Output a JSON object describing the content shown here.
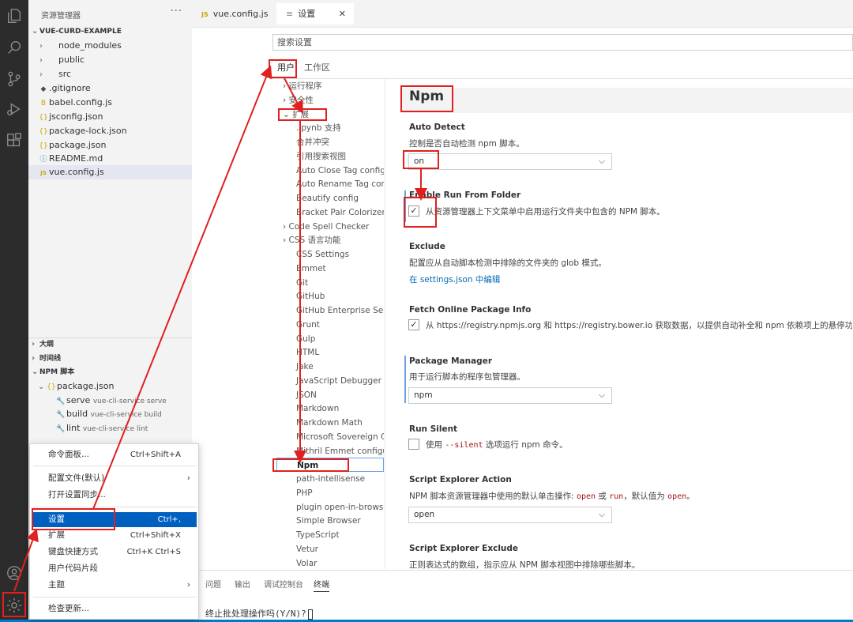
{
  "explorer": {
    "title": "资源管理器",
    "more": "···",
    "project": "VUE-CURD-EXAMPLE",
    "files": [
      {
        "chev": "›",
        "icon": "",
        "name": "node_modules"
      },
      {
        "chev": "›",
        "icon": "",
        "name": "public"
      },
      {
        "chev": "›",
        "icon": "",
        "name": "src"
      },
      {
        "chev": "",
        "icon": "◆",
        "name": ".gitignore"
      },
      {
        "chev": "",
        "icon": "B",
        "name": "babel.config.js"
      },
      {
        "chev": "",
        "icon": "{}",
        "name": "jsconfig.json"
      },
      {
        "chev": "",
        "icon": "{}",
        "name": "package-lock.json"
      },
      {
        "chev": "",
        "icon": "{}",
        "name": "package.json"
      },
      {
        "chev": "",
        "icon": "ⓘ",
        "name": "README.md"
      },
      {
        "chev": "",
        "icon": "JS",
        "name": "vue.config.js"
      }
    ],
    "outline": "大纲",
    "timeline": "时间线",
    "npm_scripts": "NPM 脚本",
    "npm_package": "package.json",
    "scripts": [
      {
        "name": "serve",
        "cmd": "vue-cli-service serve"
      },
      {
        "name": "build",
        "cmd": "vue-cli-service build"
      },
      {
        "name": "lint",
        "cmd": "vue-cli-service lint"
      }
    ]
  },
  "tabs": [
    {
      "badge": "JS",
      "label": "vue.config.js"
    },
    {
      "badge": "≡",
      "label": "设置",
      "close": "✕"
    }
  ],
  "settings": {
    "search_placeholder": "搜索设置",
    "scope_user": "用户",
    "scope_workspace": "工作区",
    "toc": [
      {
        "label": "› 运行程序",
        "indent": 0
      },
      {
        "label": "› 安全性",
        "indent": 0
      },
      {
        "label": "⌄ 扩展",
        "indent": 0
      },
      {
        "label": ".ipynb 支持",
        "indent": 1
      },
      {
        "label": "合并冲突",
        "indent": 1
      },
      {
        "label": "引用搜索视图",
        "indent": 1
      },
      {
        "label": "Auto Close Tag config...",
        "indent": 1
      },
      {
        "label": "Auto Rename Tag con...",
        "indent": 1
      },
      {
        "label": "Beautify config",
        "indent": 1
      },
      {
        "label": "Bracket Pair Colorizer 2",
        "indent": 1
      },
      {
        "label": "› Code Spell Checker",
        "indent": 0
      },
      {
        "label": "› CSS 语言功能",
        "indent": 0
      },
      {
        "label": "CSS Settings",
        "indent": 1
      },
      {
        "label": "Emmet",
        "indent": 1
      },
      {
        "label": "Git",
        "indent": 1
      },
      {
        "label": "GitHub",
        "indent": 1
      },
      {
        "label": "GitHub Enterprise Ser...",
        "indent": 1
      },
      {
        "label": "Grunt",
        "indent": 1
      },
      {
        "label": "Gulp",
        "indent": 1
      },
      {
        "label": "HTML",
        "indent": 1
      },
      {
        "label": "Jake",
        "indent": 1
      },
      {
        "label": "JavaScript Debugger",
        "indent": 1
      },
      {
        "label": "JSON",
        "indent": 1
      },
      {
        "label": "Markdown",
        "indent": 1
      },
      {
        "label": "Markdown Math",
        "indent": 1
      },
      {
        "label": "Microsoft Sovereign C...",
        "indent": 1
      },
      {
        "label": "Mithril Emmet configu...",
        "indent": 1
      },
      {
        "label": "Npm",
        "indent": 1
      },
      {
        "label": "path-intellisense",
        "indent": 1
      },
      {
        "label": "PHP",
        "indent": 1
      },
      {
        "label": "plugin open-in-browser",
        "indent": 1
      },
      {
        "label": "Simple Browser",
        "indent": 1
      },
      {
        "label": "TypeScript",
        "indent": 1
      },
      {
        "label": "Vetur",
        "indent": 1
      },
      {
        "label": "Volar",
        "indent": 1
      }
    ],
    "section_title": "Npm",
    "auto_detect": {
      "title": "Auto Detect",
      "desc": "控制是否自动检测 npm 脚本。",
      "value": "on"
    },
    "run_from_folder": {
      "title": "Enable Run From Folder",
      "label": "从资源管理器上下文菜单中启用运行文件夹中包含的 NPM 脚本。",
      "check": "✓"
    },
    "exclude": {
      "title": "Exclude",
      "desc": "配置应从自动脚本检测中排除的文件夹的 glob 模式。",
      "link": "在 settings.json 中编辑"
    },
    "fetch_info": {
      "title": "Fetch Online Package Info",
      "label": "从 https://registry.npmjs.org 和 https://registry.bower.io 获取数据，以提供自动补全和 npm 依赖项上的悬停功能信息。",
      "check": "✓"
    },
    "package_manager": {
      "title": "Package Manager",
      "desc": "用于运行脚本的程序包管理器。",
      "value": "npm"
    },
    "run_silent": {
      "title": "Run Silent",
      "pre": "使用 ",
      "code": "--silent",
      "post": " 选项运行 npm 命令。"
    },
    "explorer_action": {
      "title": "Script Explorer Action",
      "d1": "NPM 脚本资源管理器中使用的默认单击操作: ",
      "c1": "open",
      "d2": " 或 ",
      "c2": "run",
      "d3": "，默认值为 ",
      "c3": "open",
      "d4": "。",
      "value": "open"
    },
    "explorer_exclude": {
      "title": "Script Explorer Exclude",
      "desc": "正则表达式的数组，指示应从 NPM 脚本视图中排除哪些脚本。"
    }
  },
  "panel": {
    "tabs": [
      "问题",
      "输出",
      "调试控制台",
      "终端"
    ],
    "terminal_text": "终止批处理操作吗(Y/N)?"
  },
  "menu": {
    "items": [
      {
        "label": "命令面板...",
        "kbd": "Ctrl+Shift+A"
      },
      {
        "label": "配置文件(默认)",
        "kbd": "",
        "arrow": "›"
      },
      {
        "label": "打开设置同步...",
        "kbd": ""
      },
      {
        "label": "设置",
        "kbd": "Ctrl+,"
      },
      {
        "label": "扩展",
        "kbd": "Ctrl+Shift+X"
      },
      {
        "label": "键盘快捷方式",
        "kbd": "Ctrl+K Ctrl+S"
      },
      {
        "label": "用户代码片段",
        "kbd": ""
      },
      {
        "label": "主题",
        "kbd": "",
        "arrow": "›"
      },
      {
        "label": "检查更新...",
        "kbd": ""
      }
    ]
  },
  "colors": {
    "accent": "#0060c0",
    "annotation": "#e02020",
    "activity_bar": "#2c2c2c",
    "status_bar": "#007acc"
  }
}
